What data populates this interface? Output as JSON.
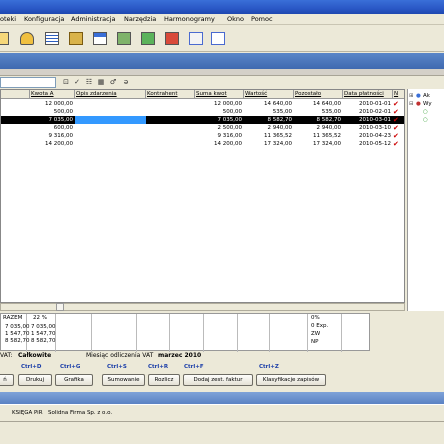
{
  "menu": [
    "oteki",
    "Konfiguracja",
    "Administracja",
    "Narzędzia",
    "Harmonogramy",
    "Okno",
    "Pomoc"
  ],
  "toolbar_icons": [
    "folder-open-icon",
    "user-card-icon",
    "list-icon",
    "tools-icon",
    "window-icon",
    "calculator-icon",
    "document-icon",
    "home-icon",
    "envelope-icon"
  ],
  "filter": {
    "search_value": "",
    "buttons": [
      "⊡",
      "✓",
      "☷",
      "▦",
      "♂",
      "ǝ"
    ]
  },
  "grid": {
    "headers": [
      "Kwota A",
      "Opis zdarzenia",
      "Kontrahent",
      "Suma kwot",
      "Wartość",
      "Pozostało",
      "Data płatności",
      "N"
    ],
    "rows": [
      {
        "kwota": "12 000,00",
        "opis": "",
        "kontrahent": "",
        "suma": "12 000,00",
        "wartosc": "14 640,00",
        "pozostalo": "14 640,00",
        "data": "2010-01-01",
        "check": "✔",
        "selected": false
      },
      {
        "kwota": "500,00",
        "opis": "",
        "kontrahent": "",
        "suma": "500,00",
        "wartosc": "535,00",
        "pozostalo": "535,00",
        "data": "2010-02-01",
        "check": "✔",
        "selected": false
      },
      {
        "kwota": "7 035,00",
        "opis": "",
        "kontrahent": "",
        "suma": "7 035,00",
        "wartosc": "8 582,70",
        "pozostalo": "8 582,70",
        "data": "2010-03-01",
        "check": "✔",
        "selected": true
      },
      {
        "kwota": "600,00",
        "opis": "",
        "kontrahent": "",
        "suma": "2 500,00",
        "wartosc": "2 940,00",
        "pozostalo": "2 940,00",
        "data": "2010-03-10",
        "check": "✔",
        "selected": false
      },
      {
        "kwota": "9 316,00",
        "opis": "",
        "kontrahent": "",
        "suma": "9 316,00",
        "wartosc": "11 365,52",
        "pozostalo": "11 365,52",
        "data": "2010-04-23",
        "check": "✔",
        "selected": false
      },
      {
        "kwota": "14 200,00",
        "opis": "",
        "kontrahent": "",
        "suma": "14 200,00",
        "wartosc": "17 324,00",
        "pozostalo": "17 324,00",
        "data": "2010-05-12",
        "check": "✔",
        "selected": false
      }
    ]
  },
  "rightpanel": {
    "items": [
      "Ak",
      "Wy"
    ]
  },
  "summary": {
    "razem_label": "RAZEM",
    "percent": "22 %",
    "col1": [
      "7 035,00",
      "1 547,70",
      "8 582,70"
    ],
    "col2": [
      "7 035,00",
      "1 547,70",
      "8 582,70"
    ],
    "vat_rates": [
      "0%",
      "0 Exp.",
      "ZW",
      "NP"
    ]
  },
  "vat": {
    "label": "VAT:",
    "value": "Całkowite",
    "month_label": "Miesiąc odliczenia VAT",
    "month_value": "marzec 2010"
  },
  "shortcuts": [
    "Ctrl+D",
    "Ctrl+G",
    "Ctrl+S",
    "Ctrl+R",
    "Ctrl+F",
    "Ctrl+Z"
  ],
  "buttons": [
    "ń",
    "Drukuj",
    "Grafika",
    "Sumowanie",
    "Rozlicz",
    "Dodaj zest. faktur",
    "Klasyfikacje zapisów"
  ],
  "status": {
    "left": "KSIĘGA PiR",
    "company": "Solidna Firma Sp. z o.o."
  },
  "colors": {
    "title_blue": "#2a58c6",
    "selection": "#000000",
    "selection_highlight": "#3399ff",
    "check_red": "#cc0000",
    "shortcut_blue": "#1a3da8"
  }
}
